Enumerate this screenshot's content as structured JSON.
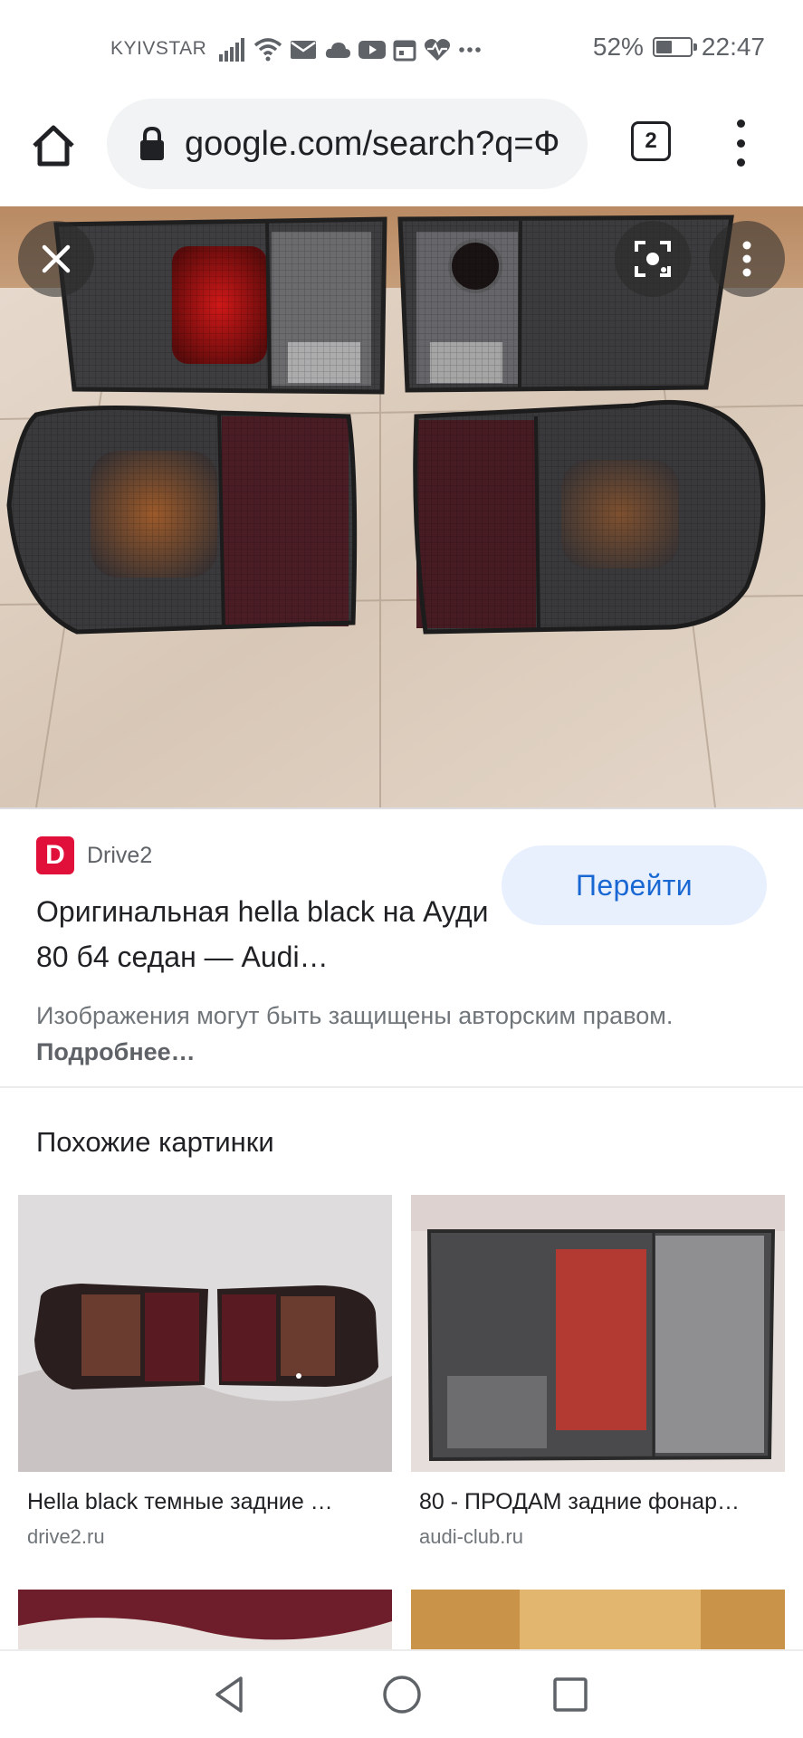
{
  "status_bar": {
    "carrier": "KYIVSTAR",
    "battery_percent": "52%",
    "battery_level": 0.52,
    "time": "22:47",
    "icons": [
      "signal-icon",
      "wifi-icon",
      "mail-icon",
      "cloud-icon",
      "youtube-icon",
      "calendar-icon",
      "heart-rate-icon",
      "more-icon"
    ]
  },
  "browser": {
    "url": "google.com/search?q=Ф",
    "tab_count": "2"
  },
  "result": {
    "source_initial": "D",
    "source_name": "Drive2",
    "title": "Оригинальная hella black на Ауди 80 б4 седан — Audi…",
    "visit_label": "Перейти",
    "copyright_text": "Изображения могут быть защищены авторским правом.",
    "copyright_link": "Подробнее…"
  },
  "related": {
    "heading": "Похожие картинки",
    "items": [
      {
        "title": "Hella black темные задние …",
        "domain": "drive2.ru"
      },
      {
        "title": "80 - ПРОДАМ задние фонар…",
        "domain": "audi-club.ru"
      }
    ]
  },
  "colors": {
    "accent": "#1967d2",
    "visit_button_bg": "#e8f0fe",
    "favicon": "#e0103a"
  }
}
